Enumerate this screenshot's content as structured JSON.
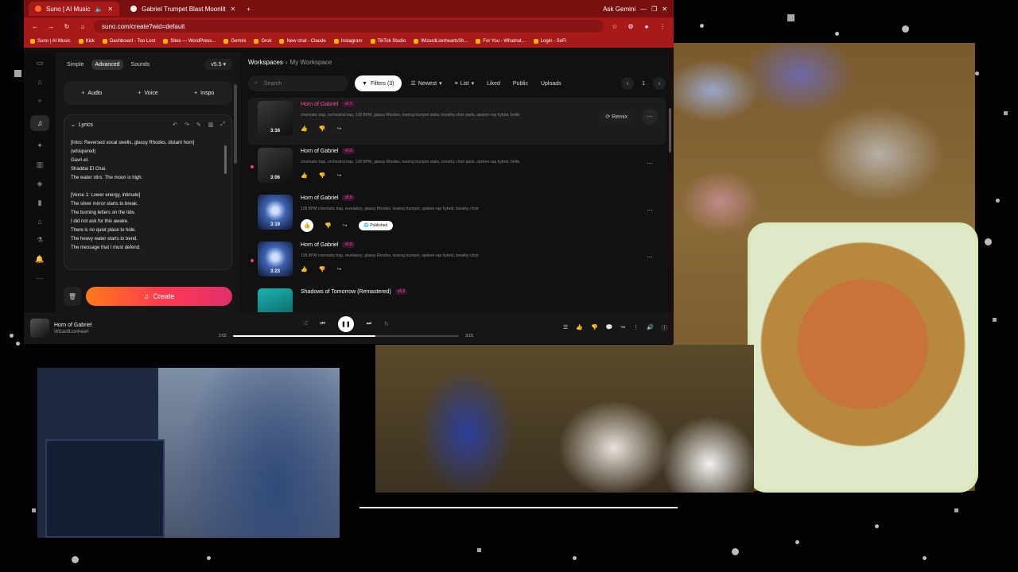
{
  "browser": {
    "tabs": [
      {
        "title": "Suno | AI Music",
        "active": true
      },
      {
        "title": "Gabriel Trumpet Blast Moonlit",
        "active": false
      }
    ],
    "ask_gemini": "Ask Gemini",
    "url": "suno.com/create?wid=default",
    "bookmarks": [
      "Suno | AI Music",
      "Kick",
      "Dashboard - Too Lost",
      "Sites — WordPress...",
      "Gemini",
      "Grok",
      "New chat - Claude",
      "Instagram",
      "TikTok Studio",
      "WizardLionheartsSh...",
      "For You - Whatnot...",
      "Login - SoFi"
    ]
  },
  "left_panel": {
    "modes": [
      "Simple",
      "Advanced",
      "Sounds"
    ],
    "version": "v5.5",
    "add_buttons": [
      "Audio",
      "Voice",
      "Inspo"
    ],
    "lyrics_label": "Lyrics",
    "lyrics_text": "[Intro: Reversed vocal swells, glassy Rhodes, distant horn]\n(whispered)\nGavri-el.\nShaddai El Chai.\nThe water stirs. The moon is high.\n\n[Verse 1: Lower energy, intimate]\nThe silver mirror starts to break.\nThe burning letters on the tide.\nI did not ask for this awake.\nThere is no quiet place to hide.\nThe heavy water starts to bend.\nThe message that I must defend.",
    "create_label": "Create"
  },
  "main": {
    "breadcrumb": {
      "root": "Workspaces",
      "current": "My Workspace"
    },
    "search_placeholder": "Search",
    "filters_label": "Filters (3)",
    "sort_label": "Newest",
    "view_label": "List",
    "tabs": [
      "Liked",
      "Public",
      "Uploads"
    ],
    "page": "1",
    "songs": [
      {
        "title": "Horn of Gabriel",
        "version": "v5.5",
        "duration": "3:16",
        "tags": "cinematic trap, orchestral trap, 128 BPM, glassy Rhodes, tearing trumpet stabs, breathy choir pads, spoken-rap hybrid, belliv",
        "playing": true,
        "remix": "Remix"
      },
      {
        "title": "Horn of Gabriel",
        "version": "v5.5",
        "duration": "3:06",
        "tags": "cinematic trap, orchestral trap, 128 BPM, glassy Rhodes, tearing trumpet stabs, breathy choir pads, spoken-rap hybrid, belliv",
        "playing": false
      },
      {
        "title": "Horn of Gabriel",
        "version": "v5.5",
        "duration": "3:19",
        "tags": "128 BPM cinematic trap, revelatory, glassy Rhodes, tearing trumpet, spoken-rap hybrid, breathy choir",
        "published": "Published"
      },
      {
        "title": "Horn of Gabriel",
        "version": "v5.5",
        "duration": "3:23",
        "tags": "128 BPM cinematic trap, revelatory, glassy Rhodes, tearing trumpet, spoken-rap hybrid, breathy choir"
      },
      {
        "title": "Shadows of Tomorrow (Remastered)",
        "version": "v5.5",
        "duration": "",
        "tags": ""
      }
    ]
  },
  "player": {
    "title": "Horn of Gabriel",
    "artist": "WizardLionheart",
    "elapsed": "2:02",
    "total": "3:15",
    "progress": 0.63
  }
}
